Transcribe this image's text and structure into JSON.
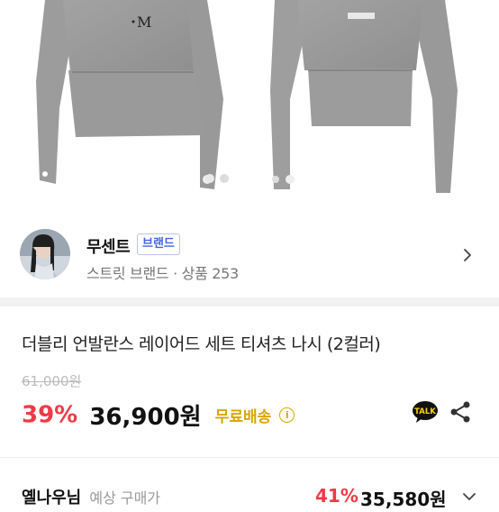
{
  "product_images": {
    "carousel_total": 2,
    "carousel_active": 2
  },
  "seller": {
    "name": "무센트",
    "badge": "브랜드",
    "meta": "스트릿 브랜드 · 상품 253"
  },
  "product": {
    "title": "더블리 언발란스 레이어드 세트 티셔츠 나시 (2컬러)",
    "original_price": "61,000원",
    "discount": "39%",
    "price": "36,900원",
    "shipping": "무료배송",
    "talk_label": "TALK"
  },
  "member_price": {
    "label": "옐나우님",
    "sub": "예상 구매가",
    "discount": "41%",
    "price": "35,580원"
  },
  "colors": {
    "discount_red": "#ee3b47",
    "shipping_gold": "#d8a600",
    "brand_blue": "#4466dd",
    "shirt_gray": "#9e9e9e"
  },
  "icons": {
    "info": "info-icon",
    "talk": "kakaotalk-icon",
    "share": "share-icon",
    "chevron": "chevron-right-icon"
  }
}
